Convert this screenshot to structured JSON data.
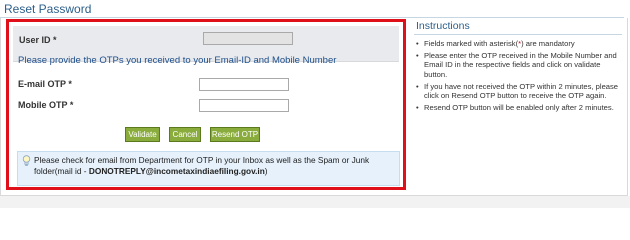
{
  "page": {
    "title": "Reset Password"
  },
  "form": {
    "user_id_label": "User ID *",
    "user_id_value": "",
    "otp_heading": "Please provide the OTPs you received to your Email-ID and Mobile Number",
    "email_otp_label": "E-mail OTP *",
    "email_otp_value": "",
    "mobile_otp_label": "Mobile OTP *",
    "mobile_otp_value": ""
  },
  "buttons": {
    "validate": "Validate",
    "cancel": "Cancel",
    "resend": "Resend OTP"
  },
  "notice": {
    "text": "Please check for email from Department for OTP in your Inbox as well as the Spam or Junk folder(mail id - ",
    "email": "DONOTREPLY@incometaxindiaefiling.gov.in",
    "suffix": ")"
  },
  "instructions": {
    "title": "Instructions",
    "item1_before": "Fields marked with asterisk(",
    "item1_asterisk": "*",
    "item1_after": ") are mandatory",
    "item2": "Please enter the OTP received in the Mobile Number and Email ID in the respective fields and click on validate button.",
    "item3": "If you have not received the OTP within 2 minutes, please click on Resend OTP button to receive the OTP again.",
    "item4": "Resend OTP button will be enabled only after 2 minutes."
  },
  "colors": {
    "accent_border": "#e0101a",
    "button_green": "#8aac3c",
    "heading_blue": "#1f4f8b",
    "notice_bg": "#e6f1fb"
  },
  "icons": [
    "lightbulb-icon",
    "bullet-icon"
  ]
}
